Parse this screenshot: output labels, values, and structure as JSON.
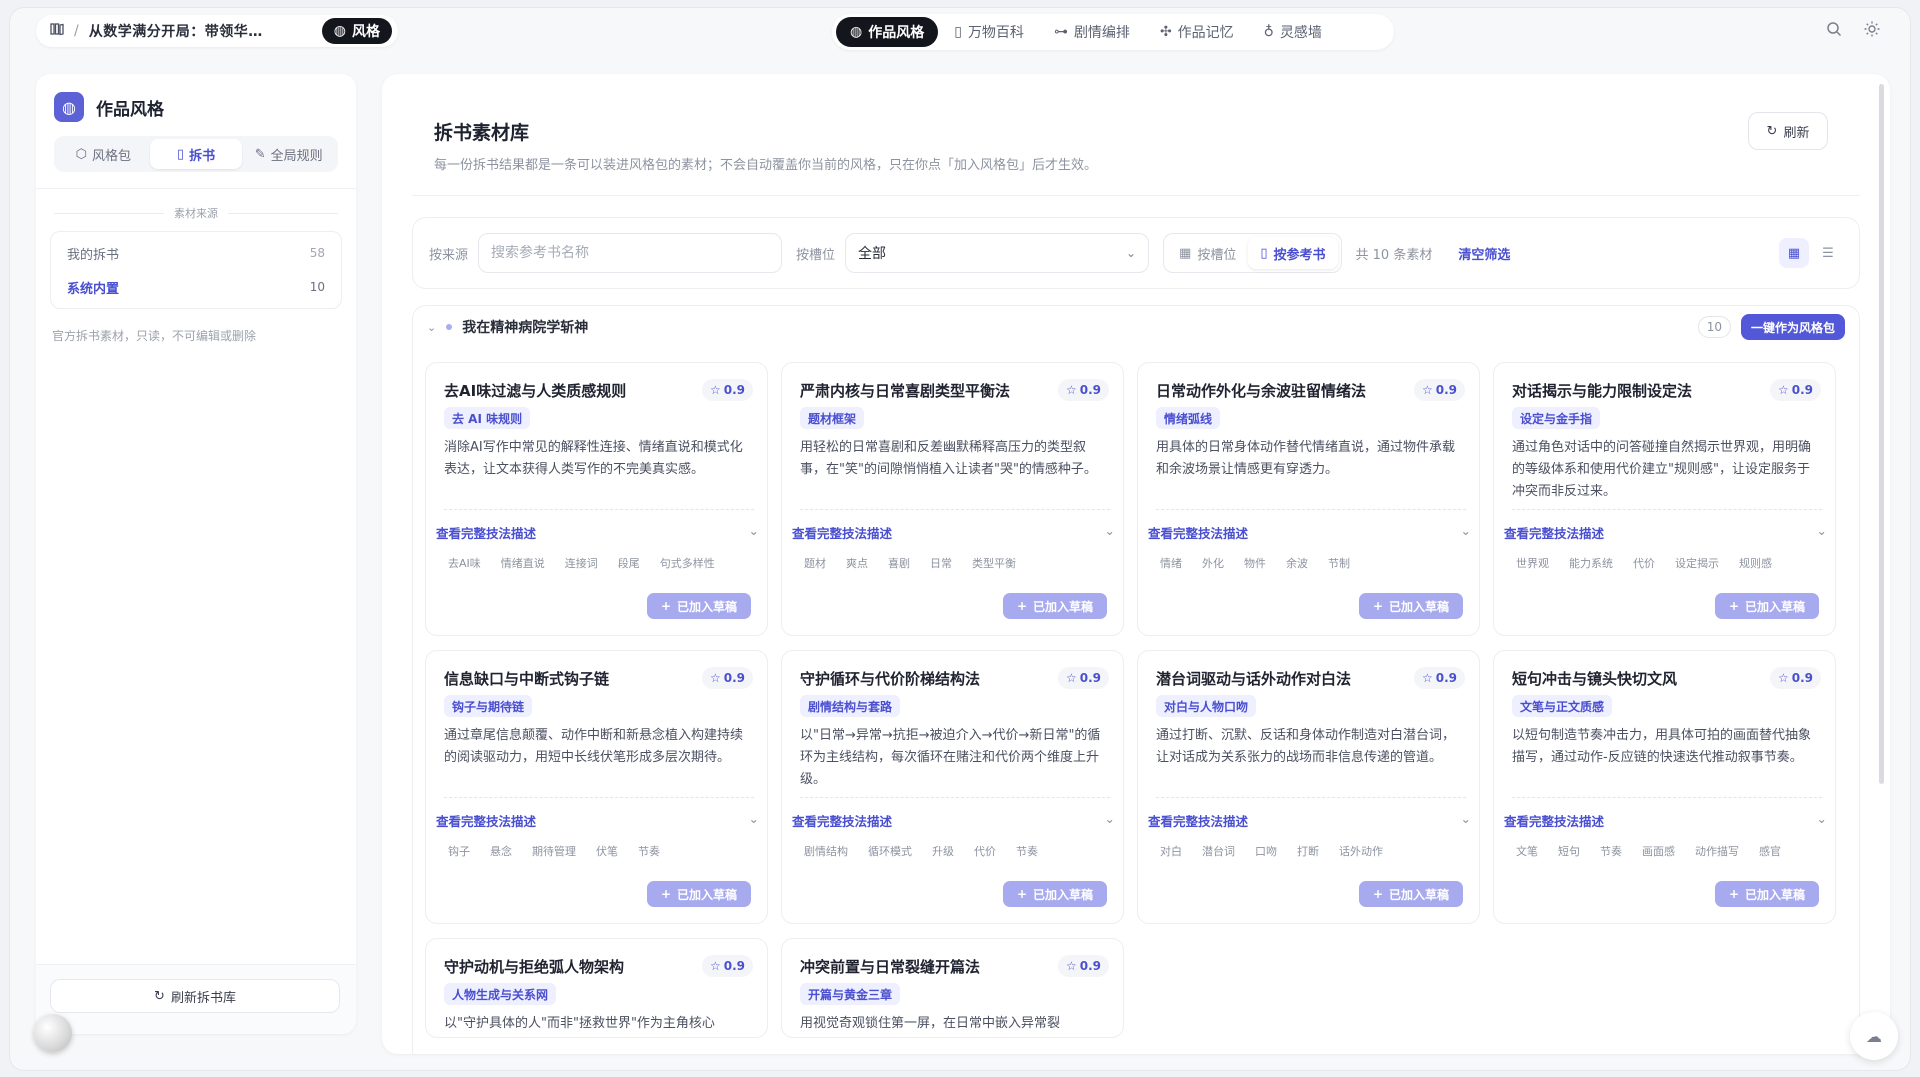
{
  "topbar": {
    "breadcrumb_title": "从数学满分开局：带领华…",
    "style_pill_label": "风格",
    "nav_tabs": [
      {
        "label": "作品风格",
        "icon": "palette-icon",
        "active": true
      },
      {
        "label": "万物百科",
        "icon": "book-icon",
        "active": false
      },
      {
        "label": "剧情编排",
        "icon": "flow-icon",
        "active": false
      },
      {
        "label": "作品记忆",
        "icon": "memory-icon",
        "active": false
      },
      {
        "label": "灵感墙",
        "icon": "bulb-icon",
        "active": false
      }
    ]
  },
  "sidebar": {
    "title": "作品风格",
    "tabs": [
      {
        "label": "风格包",
        "active": false
      },
      {
        "label": "拆书",
        "active": true
      },
      {
        "label": "全局规则",
        "active": false
      }
    ],
    "section_label": "素材来源",
    "sources": [
      {
        "label": "我的拆书",
        "count": "58",
        "active": false
      },
      {
        "label": "系统内置",
        "count": "10",
        "active": true
      }
    ],
    "note": "官方拆书素材，只读，不可编辑或删除",
    "refresh_label": "刷新拆书库"
  },
  "main": {
    "title": "拆书素材库",
    "subtitle": "每一份拆书结果都是一条可以装进风格包的素材；不会自动覆盖你当前的风格，只在你点「加入风格包」后才生效。",
    "refresh_label": "刷新",
    "filter": {
      "source_label": "按来源",
      "search_placeholder": "搜索参考书名称",
      "slot_label": "按槽位",
      "slot_value": "全部",
      "seg_by_slot": "按槽位",
      "seg_by_book": "按参考书",
      "count_text": "共 10 条素材",
      "clear_label": "清空筛选"
    },
    "group": {
      "name": "我在精神病院学斩神",
      "count": "10",
      "apply_label": "一键作为风格包"
    },
    "toggle_label": "查看完整技法描述",
    "added_label": "已加入草稿",
    "cards": [
      {
        "title": "去AI味过滤与人类质感规则",
        "score": "0.9",
        "badge": "去 AI 味规则",
        "desc": "消除AI写作中常见的解释性连接、情绪直说和模式化表达，让文本获得人类写作的不完美真实感。",
        "tags": [
          "去AI味",
          "情绪直说",
          "连接词",
          "段尾",
          "句式多样性"
        ]
      },
      {
        "title": "严肃内核与日常喜剧类型平衡法",
        "score": "0.9",
        "badge": "题材框架",
        "desc": "用轻松的日常喜剧和反差幽默稀释高压力的类型叙事，在\"笑\"的间隙悄悄植入让读者\"哭\"的情感种子。",
        "tags": [
          "题材",
          "爽点",
          "喜剧",
          "日常",
          "类型平衡"
        ]
      },
      {
        "title": "日常动作外化与余波驻留情绪法",
        "score": "0.9",
        "badge": "情绪弧线",
        "desc": "用具体的日常身体动作替代情绪直说，通过物件承载和余波场景让情感更有穿透力。",
        "tags": [
          "情绪",
          "外化",
          "物件",
          "余波",
          "节制"
        ]
      },
      {
        "title": "对话揭示与能力限制设定法",
        "score": "0.9",
        "badge": "设定与金手指",
        "desc": "通过角色对话中的问答碰撞自然揭示世界观，用明确的等级体系和使用代价建立\"规则感\"，让设定服务于冲突而非反过来。",
        "tags": [
          "世界观",
          "能力系统",
          "代价",
          "设定揭示",
          "规则感"
        ]
      },
      {
        "title": "信息缺口与中断式钩子链",
        "score": "0.9",
        "badge": "钩子与期待链",
        "desc": "通过章尾信息颠覆、动作中断和新悬念植入构建持续的阅读驱动力，用短中长线伏笔形成多层次期待。",
        "tags": [
          "钩子",
          "悬念",
          "期待管理",
          "伏笔",
          "节奏"
        ]
      },
      {
        "title": "守护循环与代价阶梯结构法",
        "score": "0.9",
        "badge": "剧情结构与套路",
        "desc": "以\"日常→异常→抗拒→被迫介入→代价→新日常\"的循环为主线结构，每次循环在赌注和代价两个维度上升级。",
        "tags": [
          "剧情结构",
          "循环模式",
          "升级",
          "代价",
          "节奏"
        ]
      },
      {
        "title": "潜台词驱动与话外动作对白法",
        "score": "0.9",
        "badge": "对白与人物口吻",
        "desc": "通过打断、沉默、反话和身体动作制造对白潜台词，让对话成为关系张力的战场而非信息传递的管道。",
        "tags": [
          "对白",
          "潜台词",
          "口吻",
          "打断",
          "话外动作"
        ]
      },
      {
        "title": "短句冲击与镜头快切文风",
        "score": "0.9",
        "badge": "文笔与正文质感",
        "desc": "以短句制造节奏冲击力，用具体可拍的画面替代抽象描写，通过动作-反应链的快速迭代推动叙事节奏。",
        "tags": [
          "文笔",
          "短句",
          "节奏",
          "画面感",
          "动作描写",
          "感官"
        ]
      },
      {
        "title": "守护动机与拒绝弧人物架构",
        "score": "0.9",
        "badge": "人物生成与关系网",
        "desc": "以\"守护具体的人\"而非\"拯救世界\"作为主角核心",
        "tags": []
      },
      {
        "title": "冲突前置与日常裂缝开篇法",
        "score": "0.9",
        "badge": "开篇与黄金三章",
        "desc": "用视觉奇观锁住第一屏，在日常中嵌入异常裂",
        "tags": []
      }
    ]
  }
}
